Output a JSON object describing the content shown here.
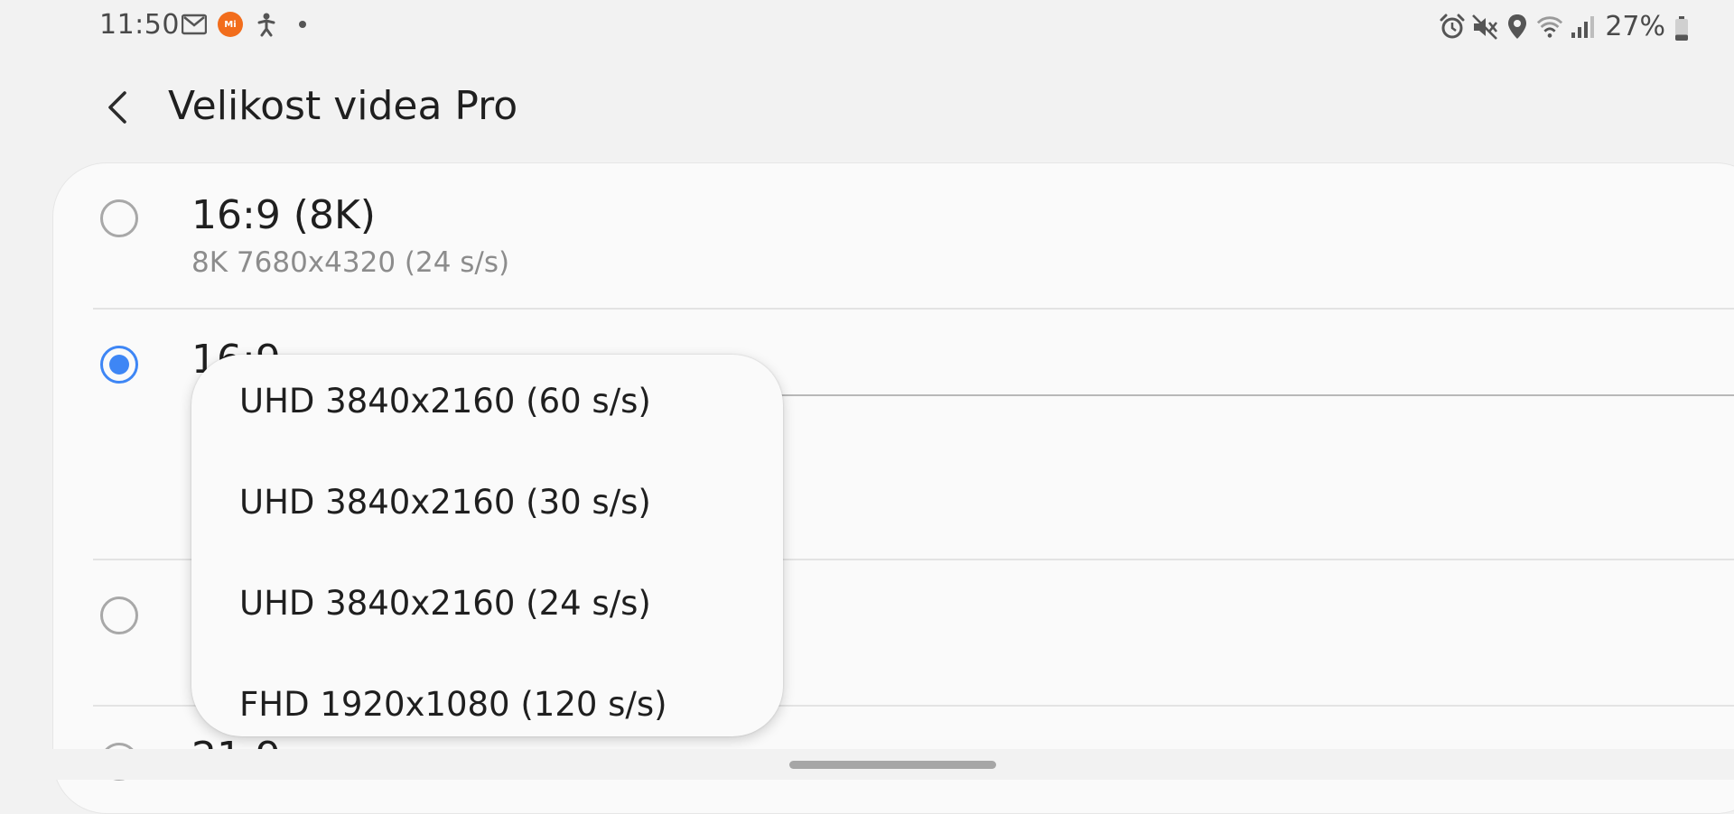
{
  "status_bar": {
    "time": "11:50",
    "left_icons": [
      "gmail-icon",
      "mi-icon",
      "accessibility-icon",
      "notification-dot"
    ],
    "mi_label": "Mi",
    "right_icons": [
      "alarm-icon",
      "mute-icon",
      "location-icon",
      "wifi-icon",
      "signal-icon"
    ],
    "battery_percent": "27%",
    "battery_level": 0.27
  },
  "header": {
    "title": "Velikost videa Pro",
    "back_icon": "back-arrow-icon"
  },
  "options": [
    {
      "title": "16:9 (8K)",
      "subtitle": "8K 7680x4320 (24 s/s)",
      "selected": false
    },
    {
      "title": "16:9",
      "subtitle": "",
      "selected": true
    },
    {
      "title": "",
      "subtitle": "",
      "selected": false
    },
    {
      "title": "21:9",
      "subtitle": "",
      "selected": false
    }
  ],
  "dropdown": {
    "items": [
      "UHD 3840x2160 (60 s/s)",
      "UHD 3840x2160 (30 s/s)",
      "UHD 3840x2160 (24 s/s)",
      "FHD 1920x1080 (120 s/s)"
    ]
  },
  "colors": {
    "accent": "#3e86f5",
    "background": "#f2f2f2",
    "card": "#fafafa",
    "mi_badge": "#f26d1c"
  }
}
